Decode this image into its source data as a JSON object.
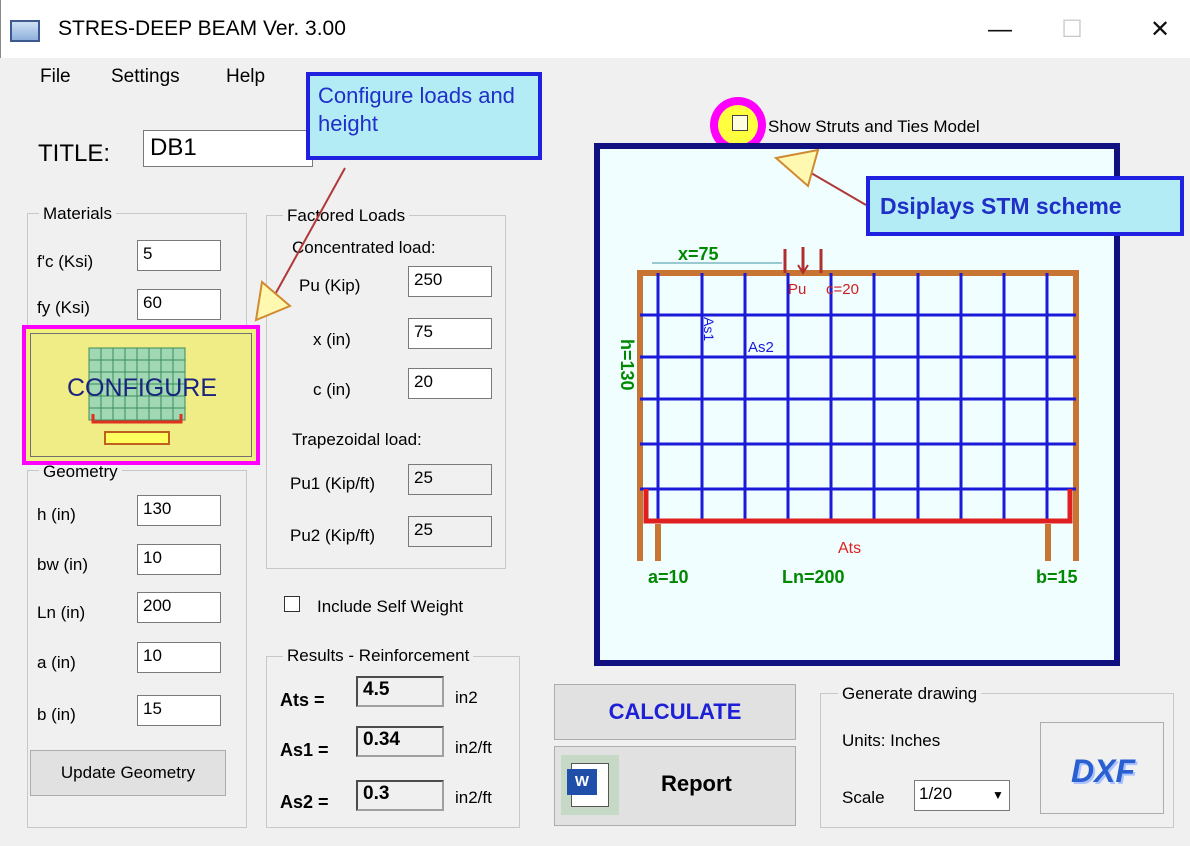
{
  "window": {
    "title": "STRES-DEEP BEAM Ver. 3.00",
    "minimize": "—",
    "maximize": "☐",
    "close": "✕"
  },
  "menu": [
    "File",
    "Settings",
    "Help"
  ],
  "title_label": "TITLE:",
  "title_value": "DB1",
  "materials": {
    "legend": "Materials",
    "fc_label": "f'c (Ksi)",
    "fc": "5",
    "fy_label": "fy (Ksi)",
    "fy": "60"
  },
  "configure": {
    "label": "CONFIGURE"
  },
  "geometry": {
    "legend": "Geometry",
    "h_label": "h (in)",
    "h": "130",
    "bw_label": "bw (in)",
    "bw": "10",
    "ln_label": "Ln (in)",
    "ln": "200",
    "a_label": "a (in)",
    "a": "10",
    "b_label": "b (in)",
    "b": "15",
    "update_label": "Update Geometry"
  },
  "loads": {
    "legend": "Factored Loads",
    "concentrated": "Concentrated load:",
    "pu_label": "Pu (Kip)",
    "pu": "250",
    "x_label": "x (in)",
    "x": "75",
    "c_label": "c (in)",
    "c": "20",
    "trapezoidal": "Trapezoidal load:",
    "pu1_label": "Pu1 (Kip/ft)",
    "pu1": "25",
    "pu2_label": "Pu2 (Kip/ft)",
    "pu2": "25"
  },
  "self_weight": {
    "label": "Include Self Weight",
    "checked": false
  },
  "results": {
    "legend": "Results - Reinforcement",
    "ats_label": "Ats =",
    "ats": "4.5",
    "ats_unit": "in2",
    "as1_label": "As1 =",
    "as1": "0.34",
    "as1_unit": "in2/ft",
    "as2_label": "As2 =",
    "as2": "0.3",
    "as2_unit": "in2/ft"
  },
  "calculate_label": "CALCULATE",
  "report_label": "Report",
  "drawing": {
    "legend": "Generate drawing",
    "units": "Units: Inches",
    "scale_label": "Scale",
    "scale": "1/20",
    "dxf": "DXF"
  },
  "stm": {
    "label": "Show Struts and Ties Model",
    "checked": false
  },
  "callouts": {
    "configure": "Configure loads and height",
    "stm": "Dsiplays STM scheme"
  },
  "beam_labels": {
    "x": "x=75",
    "pu": "Pu",
    "c": "c=20",
    "as1": "As1",
    "as2": "As2",
    "h": "h=130",
    "ats": "Ats",
    "a": "a=10",
    "ln": "Ln=200",
    "b": "b=15"
  },
  "colors": {
    "canvas_border": "#101080",
    "beam": "#c87533",
    "mesh": "#1a1ad8",
    "ats": "#e02020",
    "dims": "#008800",
    "highlight": "#ff00ff",
    "callout_bg": "#b4ecf5"
  }
}
